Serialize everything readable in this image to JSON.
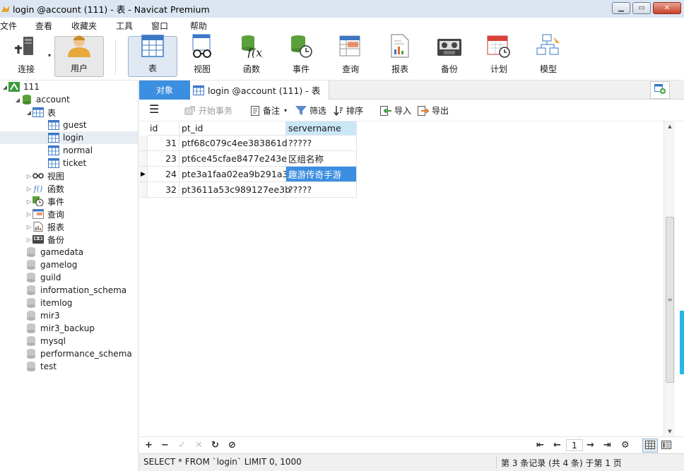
{
  "window": {
    "title": "login @account (111) - 表 - Navicat Premium",
    "controls": [
      "minimize",
      "maximize",
      "close"
    ]
  },
  "menu": [
    "文件",
    "查看",
    "收藏夹",
    "工具",
    "窗口",
    "帮助"
  ],
  "toolbar": [
    {
      "label": "连接",
      "icon": "plug-icon"
    },
    {
      "label": "用户",
      "icon": "user-icon"
    },
    {
      "label": "表",
      "icon": "table-icon",
      "active": true
    },
    {
      "label": "视图",
      "icon": "glasses-icon"
    },
    {
      "label": "函数",
      "icon": "function-icon"
    },
    {
      "label": "事件",
      "icon": "event-clock-icon"
    },
    {
      "label": "查询",
      "icon": "query-icon"
    },
    {
      "label": "报表",
      "icon": "report-icon"
    },
    {
      "label": "备份",
      "icon": "backup-tape-icon"
    },
    {
      "label": "计划",
      "icon": "calendar-icon"
    },
    {
      "label": "模型",
      "icon": "model-icon"
    }
  ],
  "sidebar": {
    "connection": "111",
    "database": "account",
    "tables_group": "表",
    "tables": [
      "guest",
      "login",
      "normal",
      "ticket"
    ],
    "selected_table": "login",
    "object_groups": [
      "视图",
      "函数",
      "事件",
      "查询",
      "报表",
      "备份"
    ],
    "databases": [
      "gamedata",
      "gamelog",
      "guild",
      "information_schema",
      "itemlog",
      "mir3",
      "mir3_backup",
      "mysql",
      "performance_schema",
      "test"
    ]
  },
  "tabs": {
    "objects": "对象",
    "current": "login @account (111) - 表"
  },
  "subtoolbar": {
    "begin_txn": "开始事务",
    "memo": "备注",
    "filter": "筛选",
    "sort": "排序",
    "import": "导入",
    "export": "导出"
  },
  "grid": {
    "columns": [
      "id",
      "pt_id",
      "servername"
    ],
    "selected_column": "servername",
    "rows": [
      {
        "id": "31",
        "pt_id": "ptf68c079c4ee383861d",
        "servername": "?????"
      },
      {
        "id": "23",
        "pt_id": "pt6ce45cfae8477e243e",
        "servername": "区组名称"
      },
      {
        "id": "24",
        "pt_id": "pte3a1faa02ea9b291a3",
        "servername": "趣游传奇手游"
      },
      {
        "id": "32",
        "pt_id": "pt3611a53c989127ee3b",
        "servername": "?????"
      }
    ],
    "current_row": 2
  },
  "nav": {
    "page": "1"
  },
  "status": {
    "sql": "SELECT * FROM `login` LIMIT 0, 1000",
    "records": "第 3 条记录 (共 4 条) 于第 1 页"
  }
}
